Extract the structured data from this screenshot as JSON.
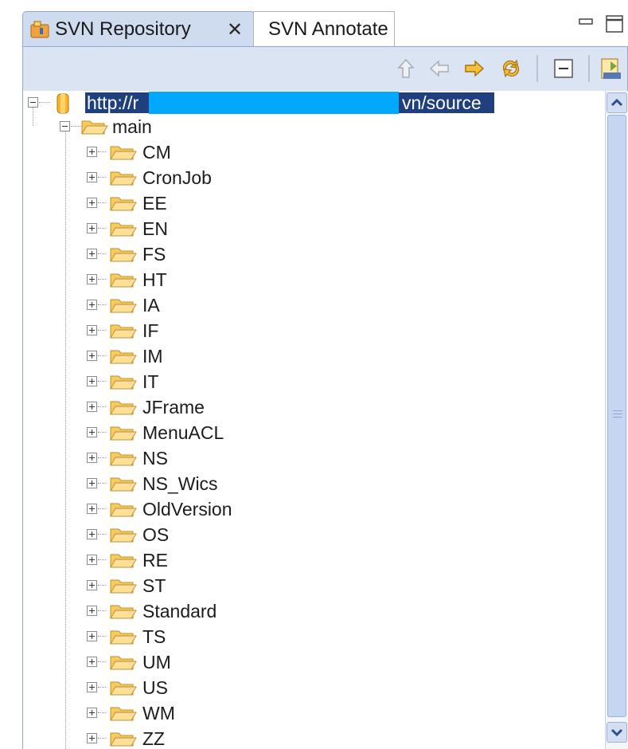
{
  "tabs": [
    {
      "label": "SVN Repository",
      "close": "✕",
      "active": true
    },
    {
      "label": "SVN Annotate",
      "active": false
    }
  ],
  "toolbar": {
    "icons": [
      "go-up-icon",
      "back-icon",
      "forward-icon",
      "refresh-icon",
      "collapse-all-icon",
      "svn-repository-location-icon"
    ]
  },
  "tree": {
    "root": {
      "url_start": "http://r",
      "url_end": "vn/source",
      "expanded": true
    },
    "main": {
      "label": "main",
      "expanded": true
    },
    "folders": [
      "CM",
      "CronJob",
      "EE",
      "EN",
      "FS",
      "HT",
      "IA",
      "IF",
      "IM",
      "IT",
      "JFrame",
      "MenuACL",
      "NS",
      "NS_Wics",
      "OldVersion",
      "OS",
      "RE",
      "ST",
      "Standard",
      "TS",
      "UM",
      "US",
      "WM",
      "ZZ"
    ]
  },
  "colors": {
    "tab_active_bg": "#cfdcef",
    "toolbar_bg": "#dbe4f2",
    "selection_bg": "#1f3f7d",
    "redaction": "#00a8ff",
    "folder_fill": "#f7c863"
  }
}
